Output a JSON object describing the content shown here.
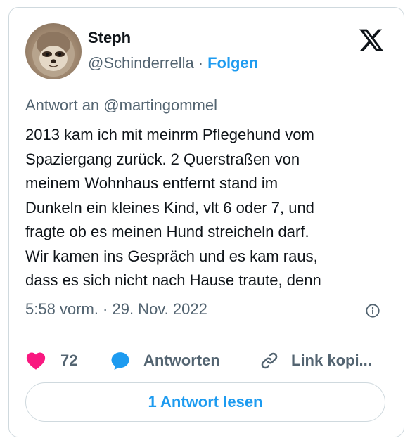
{
  "author": {
    "name": "Steph",
    "handle": "@Schinderrella",
    "separator": "·",
    "follow_label": "Folgen"
  },
  "platform": {
    "logo_icon": "x-logo-icon"
  },
  "tweet": {
    "reply_to": "Antwort an @martingommel",
    "text": "2013 kam ich mit meinrm Pflegehund vom\nSpaziergang zurück. 2 Querstraßen von\nmeinem Wohnhaus entfernt stand im\nDunkeln ein kleines Kind, vlt 6 oder 7, und\nfragte ob es meinen Hund streicheln darf.\nWir kamen ins Gespräch und es kam raus,\ndass es sich nicht nach Hause traute, denn",
    "timestamp": "5:58 vorm. · 29. Nov. 2022"
  },
  "actions": {
    "like_count": "72",
    "reply_label": "Antworten",
    "copy_link_label": "Link kopi..."
  },
  "read_replies_label": "1 Antwort lesen",
  "colors": {
    "accent": "#1d9bf0",
    "like": "#f91880",
    "text": "#0f1419",
    "muted": "#536471",
    "border": "#cfd9de"
  }
}
